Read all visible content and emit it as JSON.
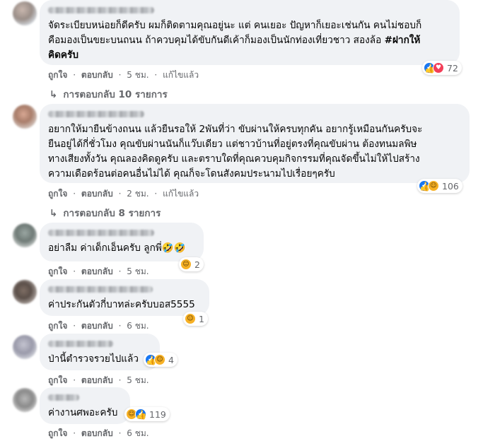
{
  "comments": [
    {
      "text_lines": [
        "จัดระเบียบหน่อยก็ดีครับ ผมก็ติดตามคุณอยู่นะ แต่ คนเยอะ ปัญหาก็เยอะเช่นกัน คนไม่ชอบก็",
        "คือมองเป็นขยะบนถนน ถ้าควบคุมได้ขับกันดีเค้าก็มองเป็นนักท่องเที่ยวชาว สองล้อ "
      ],
      "tag_line1": "#ฝากให้",
      "tag_line2": "คิดครับ",
      "like": "ถูกใจ",
      "reply": "ตอบกลับ",
      "time": "5 ชม.",
      "edited": "แก้ไขแล้ว",
      "reactions": [
        "like",
        "love"
      ],
      "reaction_count": "72",
      "replies_label": "การตอบกลับ 10 รายการ"
    },
    {
      "text_lines": [
        "อยากให้มายืนข้างถนน แล้วยืนรอให้ 2พันที่ว่า ขับผ่านให้ครบทุกคัน อยากรู้เหมือนกันครับจะ",
        "ยืนอยู่ได้กี่ชั่วโมง คุณขับผ่านนันก็แว๊บเดียว แต่ชาวบ้านที่อยู่ตรงที่คุณขับผ่าน ต้องทนมลพิษ",
        "ทางเสียงทั้งวัน คุณลองคิดดูครับ และตราบใดที่คุณควบคุมกิจกรรมที่คุณจัดขึ้นไม่ให้ไปสร้าง",
        "ความเดือดร้อนต่อคนอื่นไม่ได้ คุณก็จะโดนสังคมประนามไปเรื่อยๆครับ"
      ],
      "like": "ถูกใจ",
      "reply": "ตอบกลับ",
      "time": "2 ชม.",
      "edited": "แก้ไขแล้ว",
      "reactions": [
        "like",
        "haha"
      ],
      "reaction_count": "106",
      "replies_label": "การตอบกลับ 8 รายการ"
    },
    {
      "text": "อย่าลืม ค่าเด็กเอ็นครับ ลูกพี่🤣🤣",
      "like": "ถูกใจ",
      "reply": "ตอบกลับ",
      "time": "5 ชม.",
      "reactions": [
        "haha"
      ],
      "reaction_count": "2"
    },
    {
      "text": "ค่าประกันตัวกี่บาทล่ะครับบอส5555",
      "like": "ถูกใจ",
      "reply": "ตอบกลับ",
      "time": "6 ชม.",
      "reactions": [
        "haha"
      ],
      "reaction_count": "1"
    },
    {
      "text": "ป่านี้ตำรวจรวยไปแล้ว",
      "like": "ถูกใจ",
      "reply": "ตอบกลับ",
      "time": "5 ชม.",
      "reactions": [
        "like",
        "haha"
      ],
      "reaction_count": "4"
    },
    {
      "text": "ค่างานศพอะครับ",
      "like": "ถูกใจ",
      "reply": "ตอบกลับ",
      "time": "6 ชม.",
      "reactions": [
        "haha",
        "like"
      ],
      "reaction_count": "119"
    }
  ],
  "separator": "·",
  "colors": {
    "bubble": "#f0f2f5",
    "meta": "#65676b",
    "like": "#1877f2",
    "love": "#f33e58",
    "haha": "#f7b125"
  }
}
